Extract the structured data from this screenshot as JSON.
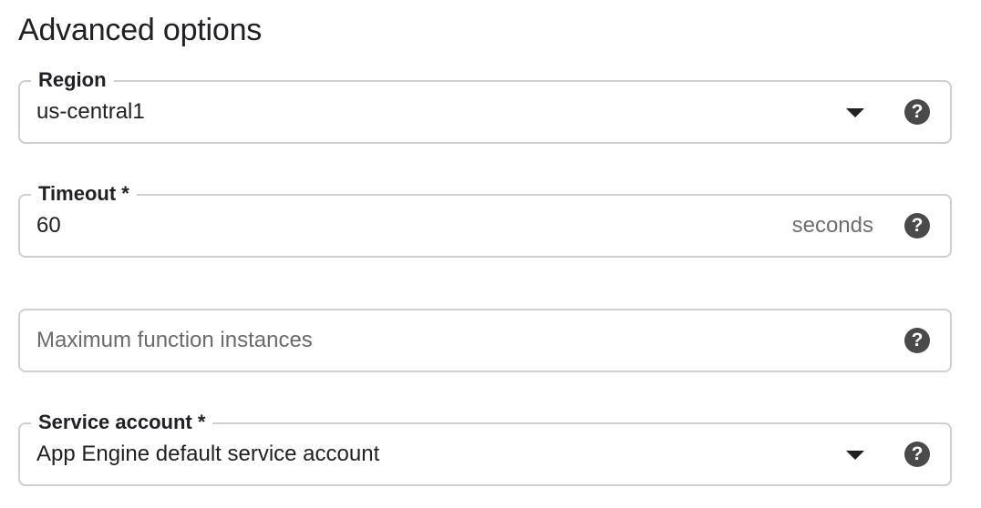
{
  "section": {
    "title": "Advanced options"
  },
  "fields": {
    "region": {
      "label": "Region",
      "value": "us-central1",
      "icons": [
        "chevron-down-icon",
        "help-icon"
      ]
    },
    "timeout": {
      "label": "Timeout *",
      "value": "60",
      "suffix": "seconds",
      "icons": [
        "help-icon"
      ]
    },
    "max_instances": {
      "placeholder": "Maximum function instances",
      "value": "",
      "icons": [
        "help-icon"
      ]
    },
    "service_account": {
      "label": "Service account *",
      "value": "App Engine default service account",
      "icons": [
        "chevron-down-icon",
        "help-icon"
      ]
    }
  },
  "help_glyph": "?",
  "colors": {
    "border": "#cfcfcf",
    "text": "#202124",
    "muted_text": "#6e6e6e",
    "icon": "#4a4a4a"
  }
}
